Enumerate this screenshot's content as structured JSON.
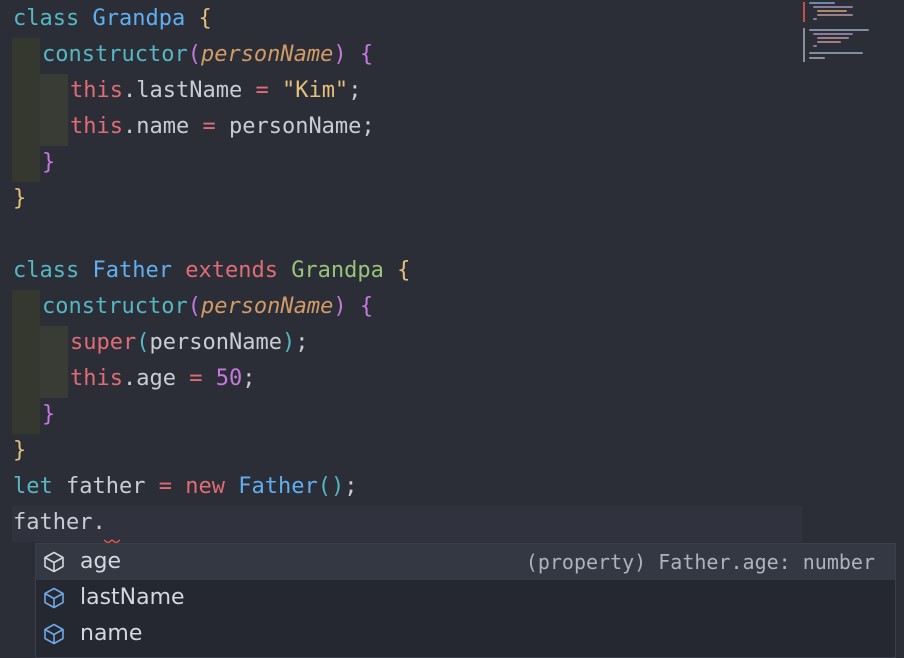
{
  "code": {
    "l1": {
      "kw": "class",
      "name": "Grandpa",
      "brace": "{"
    },
    "l2": {
      "fn": "constructor",
      "open": "(",
      "param": "personName",
      "close": ")",
      "brace": "{"
    },
    "l3": {
      "this": "this",
      "prop": ".lastName",
      "op": " = ",
      "str": "\"Kim\"",
      "semi": ";"
    },
    "l4": {
      "this": "this",
      "prop": ".name",
      "op": " = ",
      "val": "personName",
      "semi": ";"
    },
    "l5": {
      "brace": "}"
    },
    "l6": {
      "brace": "}"
    },
    "l8": {
      "kw": "class",
      "name": "Father",
      "ext": "extends",
      "base": "Grandpa",
      "brace": "{"
    },
    "l9": {
      "fn": "constructor",
      "open": "(",
      "param": "personName",
      "close": ")",
      "brace": "{"
    },
    "l10": {
      "super": "super",
      "open": "(",
      "arg": "personName",
      "close": ")",
      "semi": ";"
    },
    "l11": {
      "this": "this",
      "prop": ".age",
      "op": " = ",
      "num": "50",
      "semi": ";"
    },
    "l12": {
      "brace": "}"
    },
    "l13": {
      "brace": "}"
    },
    "l14": {
      "kw": "let",
      "var": "father",
      "op": " = ",
      "new": "new",
      "cls": "Father",
      "call": "()",
      "semi": ";"
    },
    "l15": {
      "text": "father."
    }
  },
  "suggest": {
    "items": [
      {
        "label": "age",
        "detail": "(property) Father.age: number",
        "selected": true
      },
      {
        "label": "lastName"
      },
      {
        "label": "name"
      }
    ]
  },
  "colors": {
    "background": "#2b2e37",
    "selection": "#343842"
  },
  "icons": {
    "suggest_item": "property-cube-icon"
  }
}
